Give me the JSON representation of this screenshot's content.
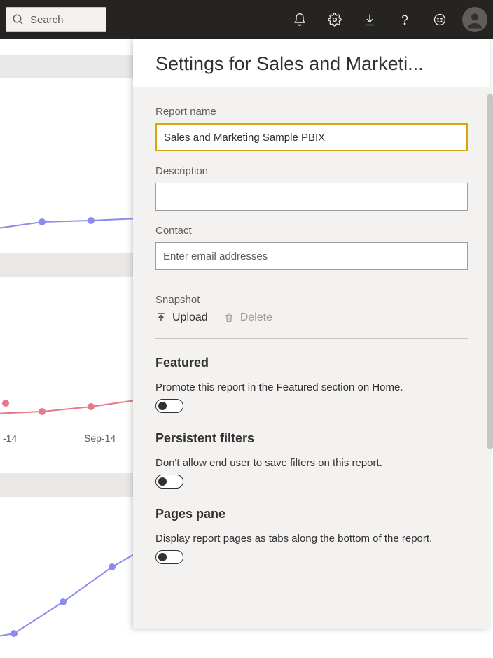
{
  "topbar": {
    "search_placeholder": "Search"
  },
  "bg": {
    "axis_label_1": "-14",
    "axis_label_2": "Sep-14"
  },
  "settings": {
    "title": "Settings for Sales and Marketi...",
    "report_name_label": "Report name",
    "report_name_value": "Sales and Marketing Sample PBIX",
    "description_label": "Description",
    "description_value": "",
    "contact_label": "Contact",
    "contact_placeholder": "Enter email addresses",
    "snapshot_label": "Snapshot",
    "upload_label": "Upload",
    "delete_label": "Delete",
    "featured": {
      "title": "Featured",
      "desc": "Promote this report in the Featured section on Home.",
      "on": false
    },
    "persistent_filters": {
      "title": "Persistent filters",
      "desc": "Don't allow end user to save filters on this report.",
      "on": false
    },
    "pages_pane": {
      "title": "Pages pane",
      "desc": "Display report pages as tabs along the bottom of the report.",
      "on": false
    }
  }
}
